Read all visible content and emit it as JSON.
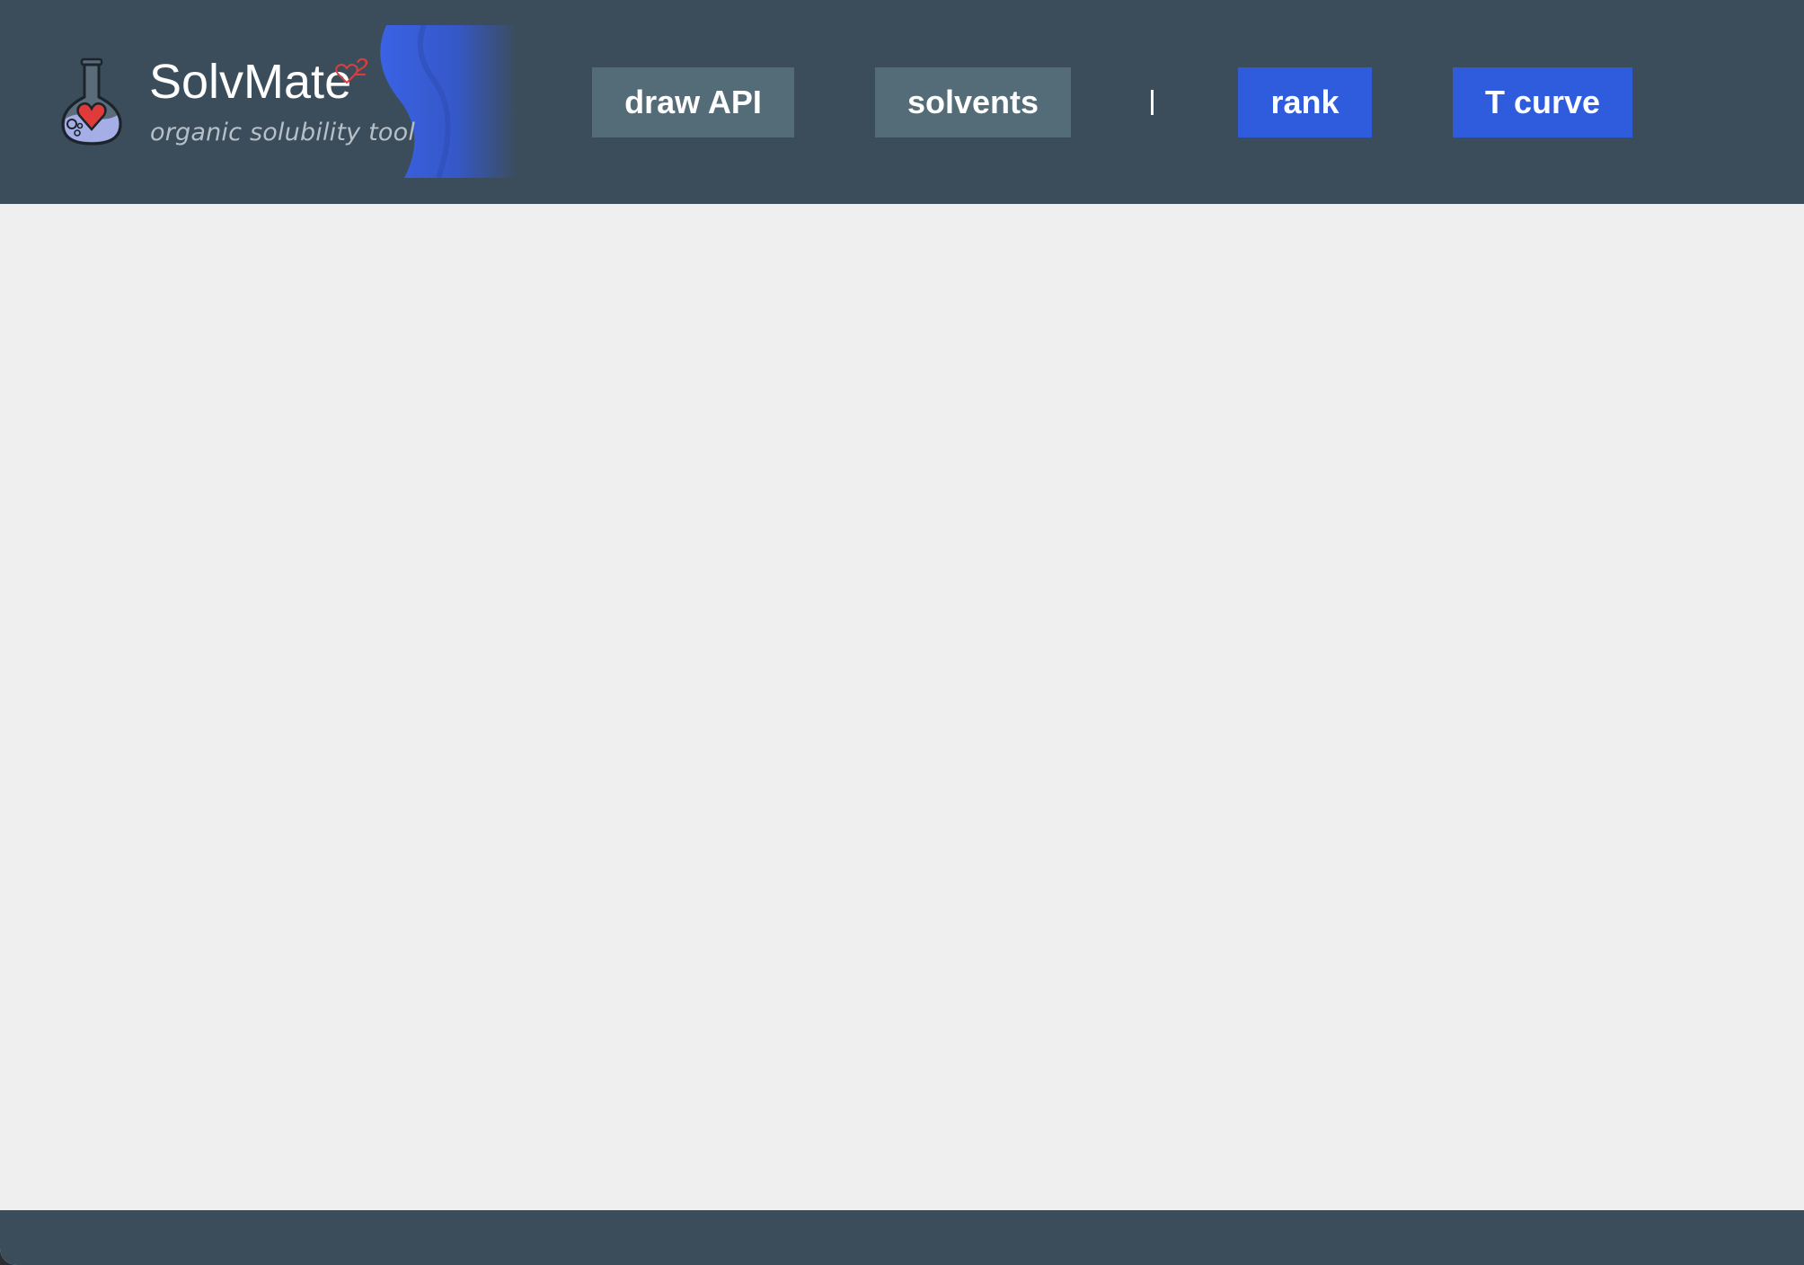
{
  "header": {
    "app_title": "SolvMate",
    "title_superscript": "2",
    "app_subtitle": "organic solubility tool"
  },
  "nav": {
    "buttons": [
      {
        "label": "draw API",
        "color": "#546b78"
      },
      {
        "label": "solvents",
        "color": "#546b78"
      },
      {
        "label": "rank",
        "color": "#2f5cdd"
      },
      {
        "label": "T curve",
        "color": "#2f5cdd"
      }
    ]
  },
  "colors": {
    "header_bg": "#3b4d5b",
    "content_bg": "#f0eff0",
    "accent_blue": "#2f5cdd",
    "heart_red": "#e03a3a",
    "flask_liquid": "#a6aee8"
  }
}
